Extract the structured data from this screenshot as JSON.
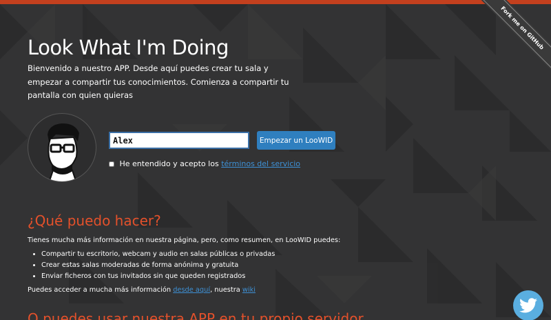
{
  "colors": {
    "accent": "#c3401e",
    "heading": "#e4512b",
    "link": "#3e91d6",
    "button": "#2f7fbf",
    "background": "#333334"
  },
  "ribbon": {
    "label": "Fork me on GitHub"
  },
  "hero": {
    "title": "Look What I'm Doing",
    "intro": "Bienvenido a nuestro APP. Desde aquí puedes crear tu sala y empezar a compartir tus conocimientos. Comienza a compartir tu pantalla con quien quieras"
  },
  "form": {
    "name_value": "Alex",
    "start_button": "Empezar un LooWID",
    "terms_text": "He entendido y acepto los",
    "terms_link": "términos del servicio"
  },
  "features": {
    "heading": "¿Qué puedo hacer?",
    "intro": "Tienes mucha más información en nuestra página, pero, como resumen, en LooWID puedes:",
    "items": [
      "Compartir tu escritorio, webcam y audio en salas públicas o privadas",
      "Crear estas salas moderadas de forma anónima y gratuita",
      "Enviar ficheros con tus invitados sin que queden registrados"
    ],
    "more_prefix": "Puedes acceder a mucha más información",
    "more_link": "desde aquí",
    "more_middle": ", nuestra",
    "wiki_link": "wiki"
  },
  "self_host": {
    "heading": "O puedes usar nuestra APP en tu propio servidor"
  },
  "icons": {
    "avatar": "avatar-icon",
    "twitter": "twitter-icon",
    "checkbox": "checkbox"
  }
}
